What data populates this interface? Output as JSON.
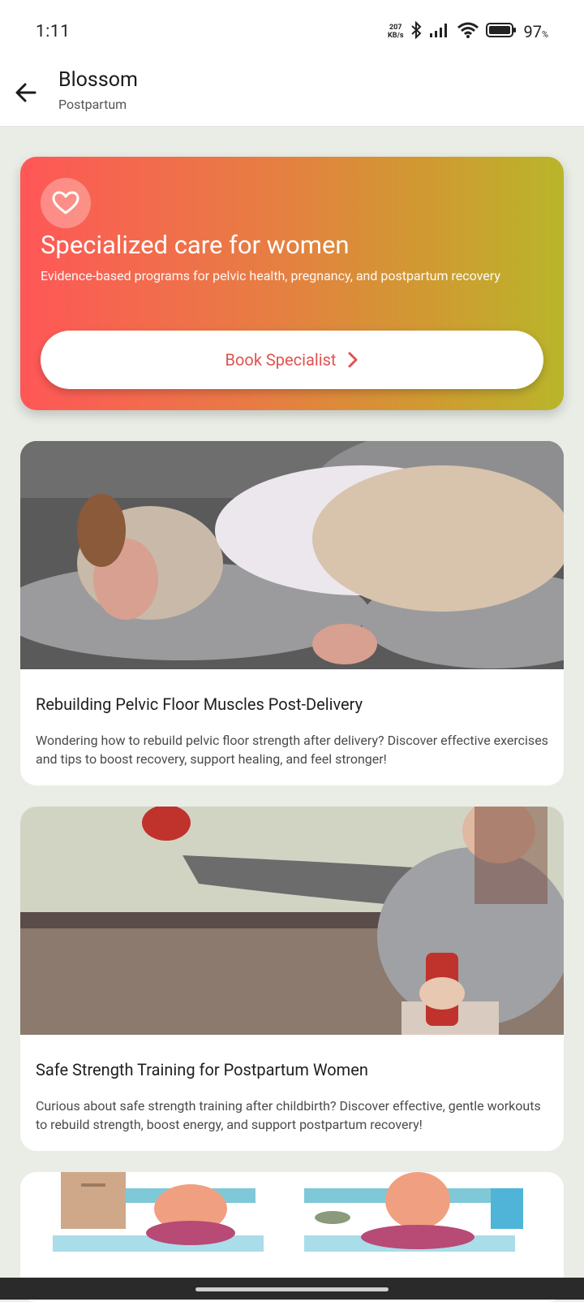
{
  "status": {
    "time": "1:11",
    "netspeed_value": "207",
    "netspeed_unit": "KB/s",
    "battery_percent": "97",
    "battery_unit": "%"
  },
  "appbar": {
    "title": "Blossom",
    "subtitle": "Postpartum"
  },
  "hero": {
    "title": "Specialized care for women",
    "description": "Evidence-based programs for pelvic health, pregnancy, and postpartum recovery",
    "button_label": "Book Specialist"
  },
  "articles": [
    {
      "title": "Rebuilding Pelvic Floor Muscles Post-Delivery",
      "description": "Wondering how to rebuild pelvic floor strength after delivery? Discover effective exercises and tips to boost recovery, support healing, and feel stronger!"
    },
    {
      "title": "Safe Strength Training for Postpartum Women",
      "description": "Curious about safe strength training after childbirth? Discover effective, gentle workouts to rebuild strength, boost energy, and support postpartum recovery!"
    }
  ],
  "colors": {
    "accent": "#e0524f",
    "hero_gradient_start": "#ff5757",
    "hero_gradient_end": "#b9b52a",
    "background": "#e9ede6"
  },
  "icons": [
    "back-arrow-icon",
    "heart-icon",
    "chevron-right-icon",
    "bluetooth-icon",
    "signal-icon",
    "wifi-icon",
    "battery-icon"
  ]
}
